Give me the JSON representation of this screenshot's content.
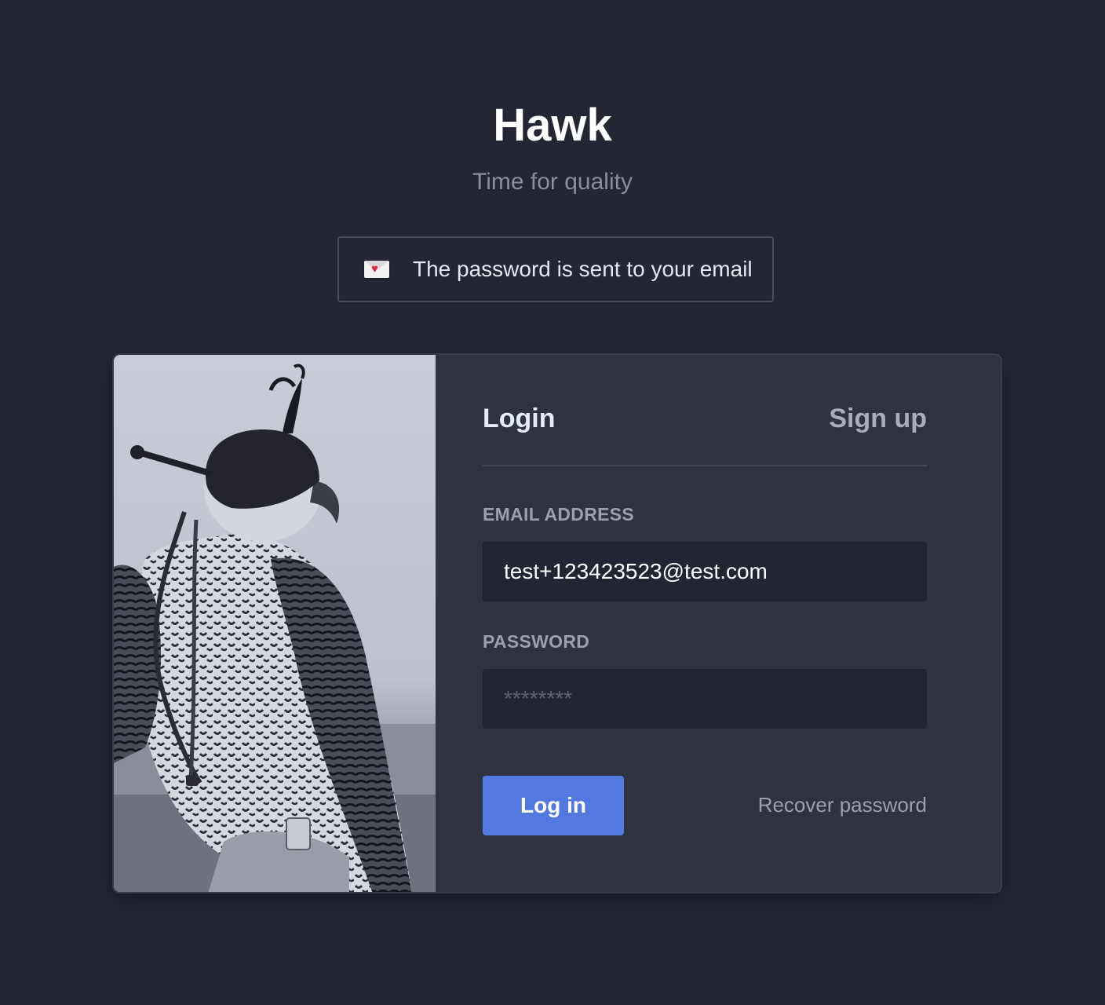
{
  "app": {
    "title": "Hawk",
    "tagline": "Time for quality"
  },
  "notice": {
    "icon": "love-letter-icon",
    "text": "The password is sent to your email"
  },
  "auth": {
    "tabs": {
      "login": "Login",
      "signup": "Sign up",
      "active": "login"
    },
    "email": {
      "label": "EMAIL ADDRESS",
      "value": "test+123423523@test.com"
    },
    "password": {
      "label": "PASSWORD",
      "placeholder": "********"
    },
    "submit_label": "Log in",
    "recover_label": "Recover password"
  },
  "colors": {
    "background": "#242633",
    "card": "#2f3240",
    "accent": "#5179e0",
    "input": "#232532"
  }
}
